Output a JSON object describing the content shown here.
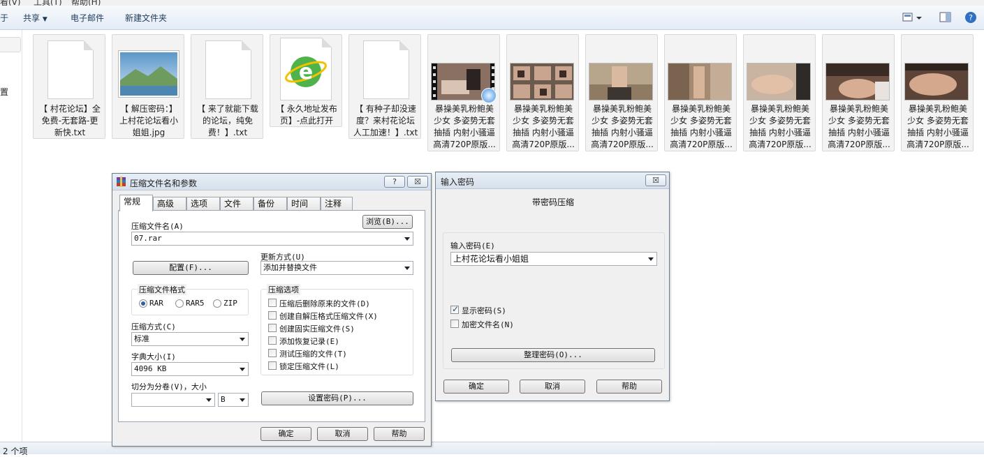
{
  "explorer": {
    "menu_partial": [
      "看(V)",
      "工具(T)",
      "帮助(H)"
    ],
    "toolbar": {
      "left_partial": "于",
      "share_label": "共享",
      "email_label": "电子邮件",
      "new_folder_label": "新建文件夹"
    },
    "left_partial_text": "置",
    "status_text": "2 个项"
  },
  "files": [
    {
      "name": "【 村花论坛】全免费-无套路-更新快.txt",
      "lines": [
        "【 村花论坛】全",
        "免费-无套路-更",
        "新快.txt"
      ],
      "type": "txt"
    },
    {
      "name": "【 解压密码：】上村花论坛看小姐姐.jpg",
      "lines": [
        "【 解压密码：】",
        "上村花论坛看小",
        "姐姐.jpg"
      ],
      "type": "jpg"
    },
    {
      "name": "【 来了就能下载的论坛，纯免费！】.txt",
      "lines": [
        "【 来了就能下载",
        "的论坛，纯免",
        "费！】.txt"
      ],
      "type": "txt"
    },
    {
      "name": "【 永久地址发布页】-点此打开",
      "lines": [
        "【 永久地址发布",
        "页】-点此打开"
      ],
      "type": "url"
    },
    {
      "name": "【 有种子却没速度？来村花论坛人工加速！】.txt",
      "lines": [
        "【 有种子却没速",
        "度？来村花论坛",
        "人工加速！】.txt"
      ],
      "type": "txt"
    },
    {
      "name": "暴操美乳粉鲍美少女 多姿势无套抽插 内射小骚逼高清720P原版...",
      "lines": [
        "暴操美乳粉鲍美",
        "少女 多姿势无套",
        "抽插 内射小骚逼",
        "高清720P原版..."
      ],
      "type": "video"
    },
    {
      "name": "暴操美乳粉鲍美少女 多姿势无套抽插 内射小骚逼高清720P原版...",
      "lines": [
        "暴操美乳粉鲍美",
        "少女 多姿势无套",
        "抽插 内射小骚逼",
        "高清720P原版..."
      ],
      "type": "video"
    },
    {
      "name": "暴操美乳粉鲍美少女 多姿势无套抽插 内射小骚逼高清720P原版...",
      "lines": [
        "暴操美乳粉鲍美",
        "少女 多姿势无套",
        "抽插 内射小骚逼",
        "高清720P原版..."
      ],
      "type": "video"
    },
    {
      "name": "暴操美乳粉鲍美少女 多姿势无套抽插 内射小骚逼高清720P原版...",
      "lines": [
        "暴操美乳粉鲍美",
        "少女 多姿势无套",
        "抽插 内射小骚逼",
        "高清720P原版..."
      ],
      "type": "video"
    },
    {
      "name": "暴操美乳粉鲍美少女 多姿势无套抽插 内射小骚逼高清720P原版...",
      "lines": [
        "暴操美乳粉鲍美",
        "少女 多姿势无套",
        "抽插 内射小骚逼",
        "高清720P原版..."
      ],
      "type": "video"
    },
    {
      "name": "暴操美乳粉鲍美少女 多姿势无套抽插 内射小骚逼高清720P原版...",
      "lines": [
        "暴操美乳粉鲍美",
        "少女 多姿势无套",
        "抽插 内射小骚逼",
        "高清720P原版..."
      ],
      "type": "video"
    },
    {
      "name": "暴操美乳粉鲍美少女 多姿势无套抽插 内射小骚逼高清720P原版...",
      "lines": [
        "暴操美乳粉鲍美",
        "少女 多姿势无套",
        "抽插 内射小骚逼",
        "高清720P原版..."
      ],
      "type": "video"
    }
  ],
  "archive_dialog": {
    "title": "压缩文件名和参数",
    "help_btn": "?",
    "close_btn": "☒",
    "tabs": [
      "常规",
      "高级",
      "选项",
      "文件",
      "备份",
      "时间",
      "注释"
    ],
    "archive_name_label": "压缩文件名(A)",
    "browse_btn": "浏览(B)...",
    "archive_name_value": "07.rar",
    "profiles_btn": "配置(F)...",
    "update_mode_label": "更新方式(U)",
    "update_mode_value": "添加并替换文件",
    "format_group": "压缩文件格式",
    "formats": [
      "RAR",
      "RAR5",
      "ZIP"
    ],
    "method_label": "压缩方式(C)",
    "method_value": "标准",
    "dict_label": "字典大小(I)",
    "dict_value": "4096 KB",
    "split_label": "切分为分卷(V)，大小",
    "split_value": "",
    "split_unit": "B",
    "options_group": "压缩选项",
    "options": [
      "压缩后删除原来的文件(D)",
      "创建自解压格式压缩文件(X)",
      "创建固实压缩文件(S)",
      "添加恢复记录(E)",
      "测试压缩的文件(T)",
      "锁定压缩文件(L)"
    ],
    "set_password_btn": "设置密码(P)...",
    "ok_btn": "确定",
    "cancel_btn": "取消",
    "help_btn2": "帮助"
  },
  "password_dialog": {
    "title": "输入密码",
    "close_btn": "☒",
    "header": "带密码压缩",
    "password_label": "输入密码(E)",
    "password_value": "上村花论坛看小姐姐",
    "show_password_label": "显示密码(S)",
    "show_password_checked": true,
    "encrypt_names_label": "加密文件名(N)",
    "encrypt_names_checked": false,
    "organize_btn": "整理密码(O)...",
    "ok_btn": "确定",
    "cancel_btn": "取消",
    "help_btn": "帮助"
  }
}
